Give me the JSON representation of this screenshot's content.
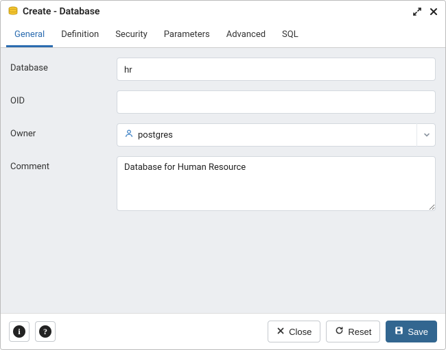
{
  "title": "Create - Database",
  "tabs": [
    {
      "label": "General"
    },
    {
      "label": "Definition"
    },
    {
      "label": "Security"
    },
    {
      "label": "Parameters"
    },
    {
      "label": "Advanced"
    },
    {
      "label": "SQL"
    }
  ],
  "activeTab": 0,
  "form": {
    "database": {
      "label": "Database",
      "value": "hr"
    },
    "oid": {
      "label": "OID",
      "value": ""
    },
    "owner": {
      "label": "Owner",
      "value": "postgres"
    },
    "comment": {
      "label": "Comment",
      "value": "Database for Human Resource"
    }
  },
  "footer": {
    "close": "Close",
    "reset": "Reset",
    "save": "Save"
  }
}
